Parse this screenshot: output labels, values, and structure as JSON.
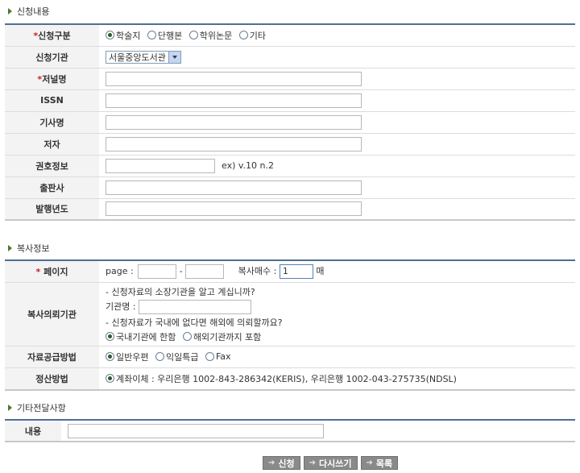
{
  "sections": {
    "apply": "신청내용",
    "copy": "복사정보",
    "other": "기타전달사항"
  },
  "apply": {
    "type_label": "신청구분",
    "type_options": [
      "학술지",
      "단행본",
      "학위논문",
      "기타"
    ],
    "org_label": "신청기관",
    "org_value": "서울중앙도서관",
    "journal_label": "저널명",
    "issn_label": "ISSN",
    "article_label": "기사명",
    "author_label": "저자",
    "volume_label": "권호정보",
    "volume_hint": "ex) v.10 n.2",
    "publisher_label": "출판사",
    "year_label": "발행년도"
  },
  "copy": {
    "page_label": "페이지",
    "page_prefix": "page :",
    "page_dash": "-",
    "count_label": "복사매수 :",
    "count_value": "1",
    "count_unit": "매",
    "request_label": "복사의뢰기관",
    "q1": "- 신청자료의 소장기관을 알고 계십니까?",
    "org_name_label": "기관명 :",
    "q2": "- 신청자료가 국내에 없다면 해외에 의뢰할까요?",
    "scope_options": [
      "국내기관에 한함",
      "해외기관까지 포함"
    ],
    "supply_label": "자료공급방법",
    "supply_options": [
      "일반우편",
      "익일특급",
      "Fax"
    ],
    "payment_label": "정산방법",
    "payment_value": "계좌이체 : 우리은행 1002-843-286342(KERIS), 우리은행 1002-043-275735(NDSL)"
  },
  "other": {
    "content_label": "내용"
  },
  "buttons": {
    "apply": "신청",
    "reset": "다시쓰기",
    "list": "목록"
  }
}
